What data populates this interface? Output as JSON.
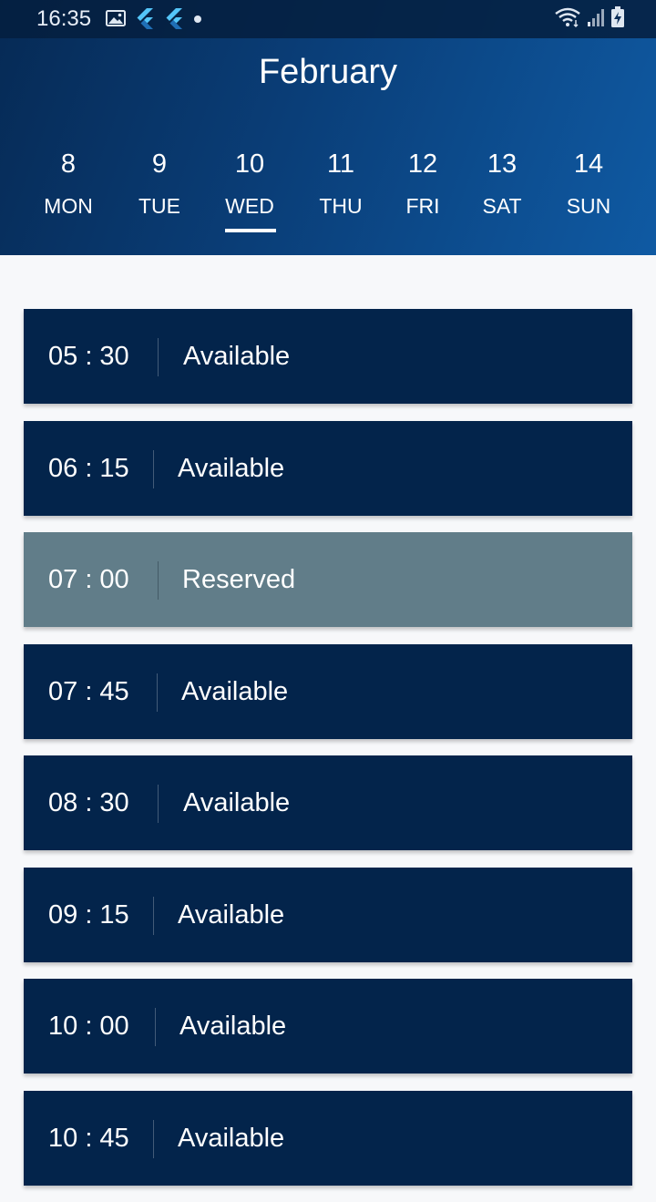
{
  "status_bar": {
    "time": "16:35",
    "left_icons": [
      "image-icon",
      "flutter-icon",
      "flutter-icon",
      "dot-icon"
    ],
    "right_icons": [
      "wifi-icon",
      "signal-icon",
      "battery-charging-icon"
    ]
  },
  "header": {
    "month": "February",
    "selected_day_index": 2,
    "days": [
      {
        "num": "8",
        "name": "MON"
      },
      {
        "num": "9",
        "name": "TUE"
      },
      {
        "num": "10",
        "name": "WED"
      },
      {
        "num": "11",
        "name": "THU"
      },
      {
        "num": "12",
        "name": "FRI"
      },
      {
        "num": "13",
        "name": "SAT"
      },
      {
        "num": "14",
        "name": "SUN"
      }
    ]
  },
  "slots": [
    {
      "time": "05 : 30",
      "status": "Available"
    },
    {
      "time": "06 : 15",
      "status": "Available"
    },
    {
      "time": "07 : 00",
      "status": "Reserved"
    },
    {
      "time": "07 : 45",
      "status": "Available"
    },
    {
      "time": "08 : 30",
      "status": "Available"
    },
    {
      "time": "09 : 15",
      "status": "Available"
    },
    {
      "time": "10 : 00",
      "status": "Available"
    },
    {
      "time": "10 : 45",
      "status": "Available"
    }
  ],
  "colors": {
    "available_bg": "#03244b",
    "reserved_bg": "#617d89",
    "header_gradient_start": "#062a55",
    "header_gradient_end": "#0f5aa3"
  }
}
